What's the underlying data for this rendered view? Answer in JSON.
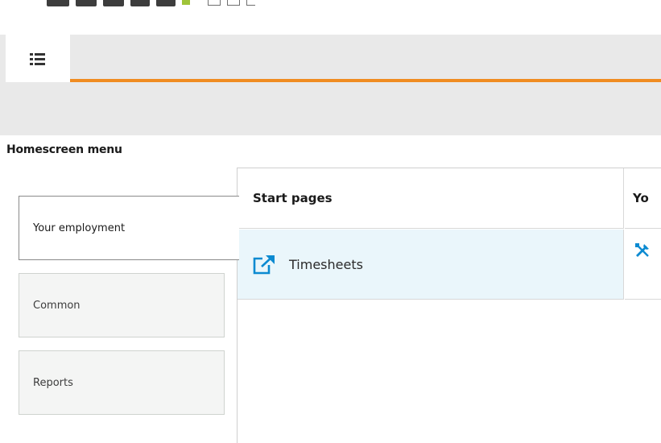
{
  "logo": {
    "name": "logo"
  },
  "menu": {
    "icon": "list-menu-icon"
  },
  "page_title": "Homescreen menu",
  "nav": [
    {
      "label": "Your employment",
      "active": true
    },
    {
      "label": "Common",
      "active": false
    },
    {
      "label": "Reports",
      "active": false
    }
  ],
  "table": {
    "columns": [
      "Start pages",
      "Yo"
    ],
    "rows": [
      {
        "label": "Timesheets",
        "icon": "external-link-icon",
        "second_icon": "tools-icon"
      }
    ]
  },
  "colors": {
    "accent": "#f08c21",
    "link": "#0b8ad1",
    "row_highlight": "#eaf6fb"
  }
}
